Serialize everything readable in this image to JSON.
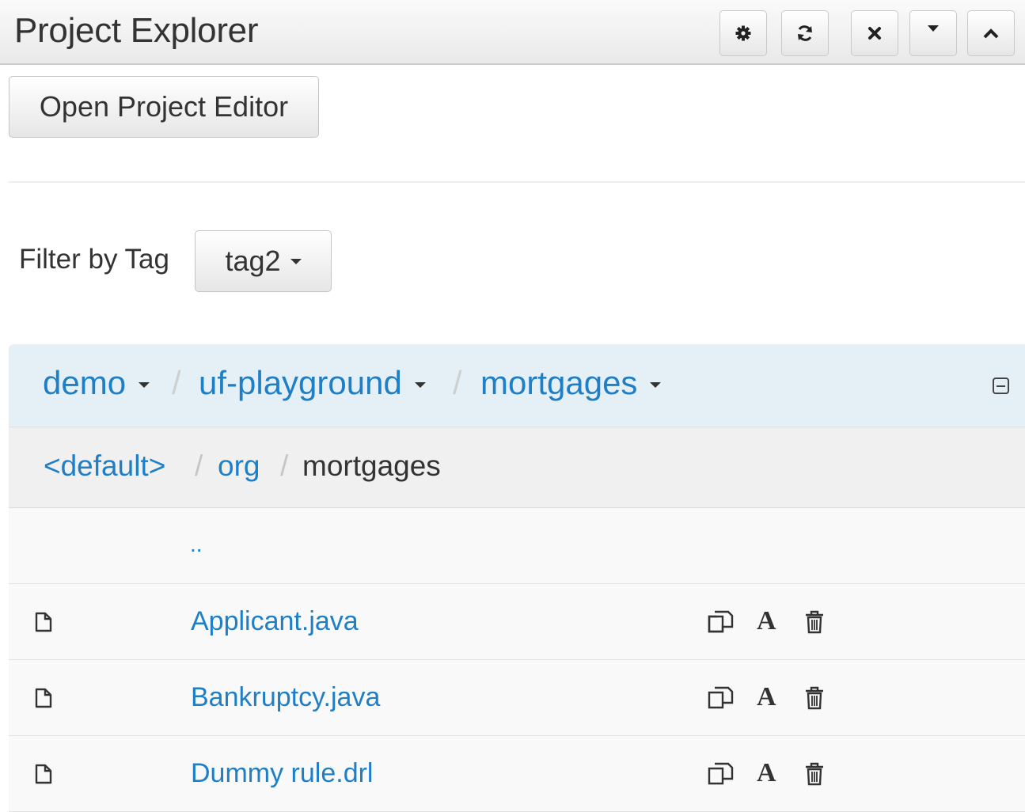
{
  "header": {
    "title": "Project Explorer",
    "buttons": [
      {
        "name": "settings-button",
        "icon": "gear-icon"
      },
      {
        "name": "refresh-button",
        "icon": "refresh-icon"
      },
      {
        "name": "close-button",
        "icon": "close-icon"
      },
      {
        "name": "dropdown-button",
        "icon": "caret-down-icon"
      },
      {
        "name": "collapse-panel-button",
        "icon": "chevron-up-icon"
      }
    ]
  },
  "toolbar": {
    "open_editor_label": "Open Project Editor"
  },
  "filter": {
    "label": "Filter by Tag",
    "selected": "tag2"
  },
  "repo_breadcrumb": {
    "items": [
      "demo",
      "uf-playground",
      "mortgages"
    ],
    "separator": "/"
  },
  "path_breadcrumb": {
    "items": [
      "<default>",
      "org",
      "mortgages"
    ],
    "separator": "/"
  },
  "files": {
    "parent_link": "..",
    "rows": [
      {
        "name": "Applicant.java"
      },
      {
        "name": "Bankruptcy.java"
      },
      {
        "name": "Dummy rule.drl"
      }
    ]
  },
  "colors": {
    "link": "#1f7fc6",
    "repo_bar": "#e5f0f6",
    "path_bar": "#f0f0f0"
  }
}
